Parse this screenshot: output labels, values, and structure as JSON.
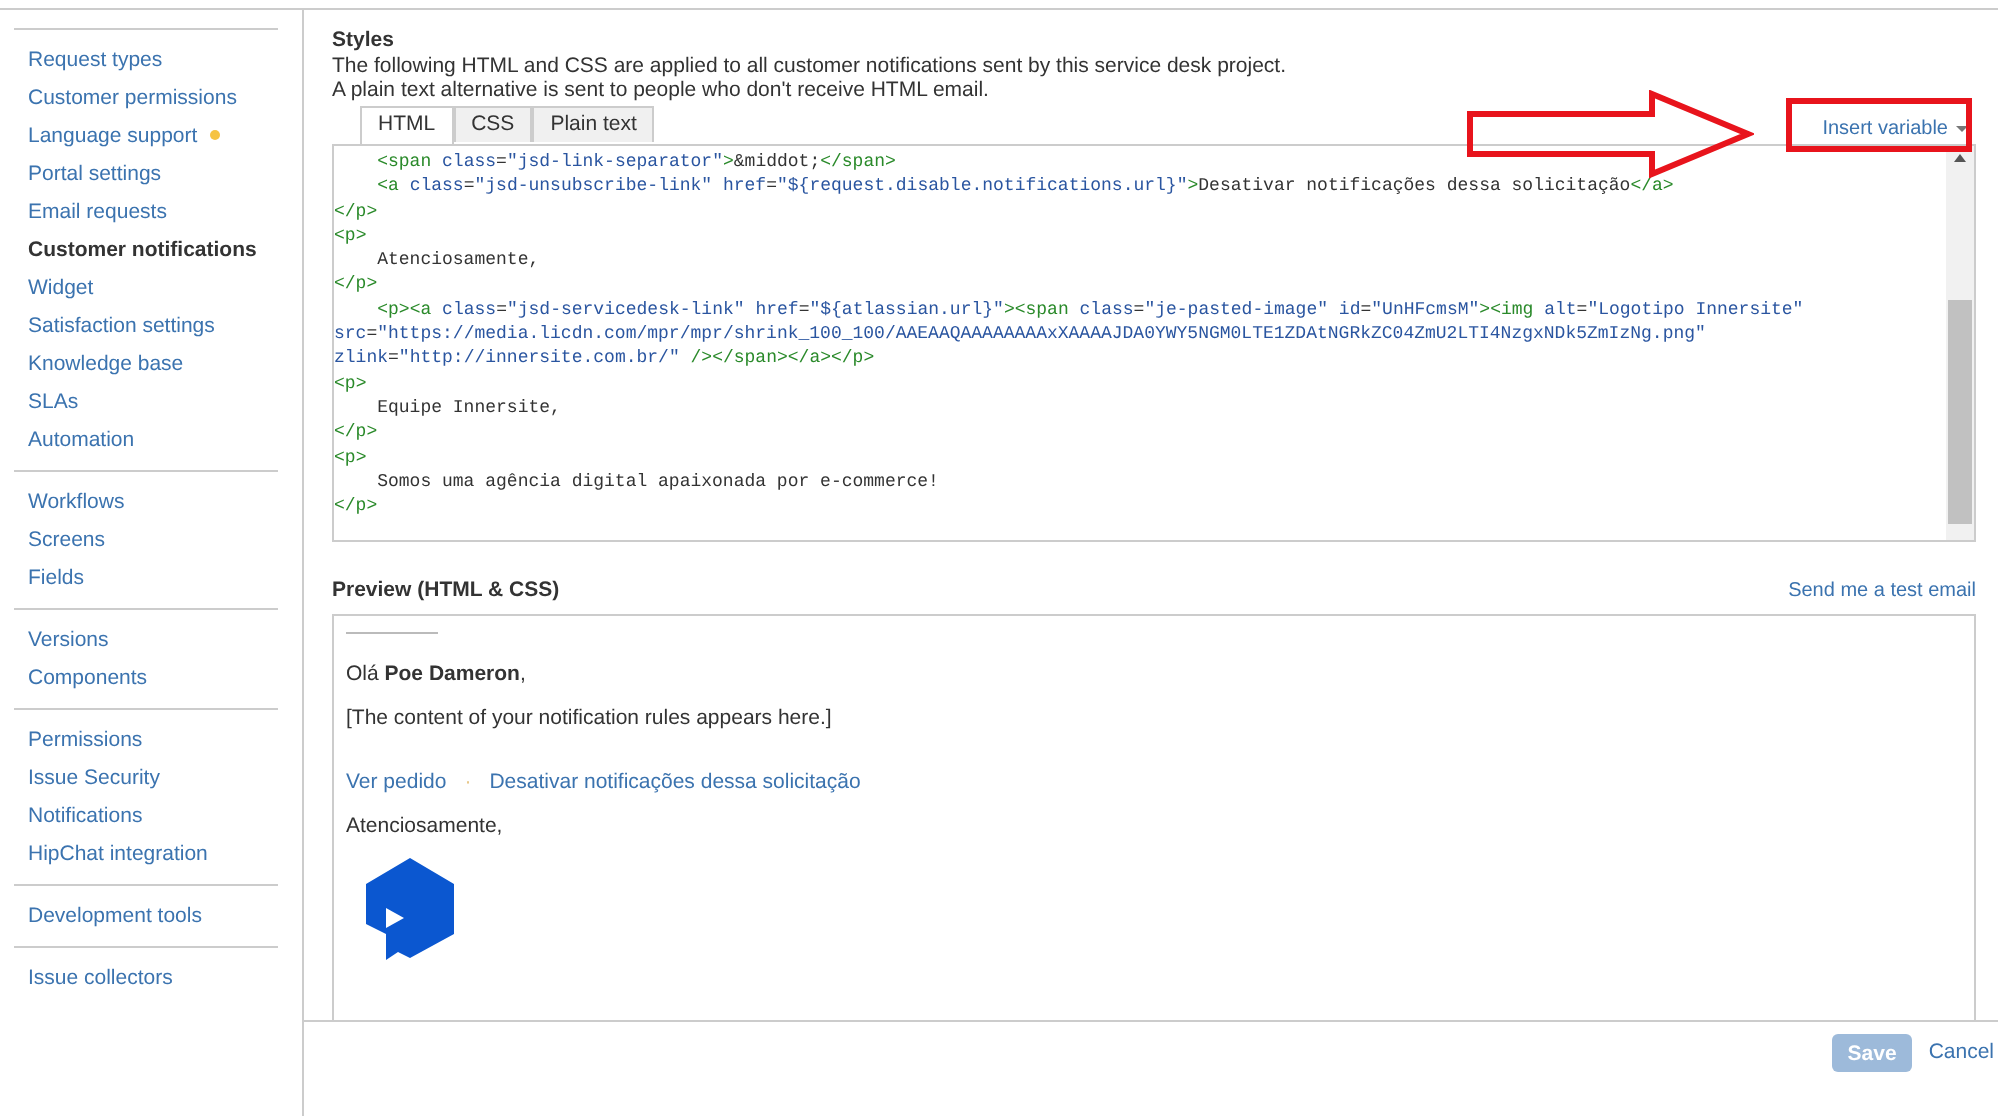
{
  "sidebar": {
    "groups": [
      {
        "items": [
          {
            "label": "Request types",
            "selected": false,
            "dot": false
          },
          {
            "label": "Customer permissions",
            "selected": false,
            "dot": false
          },
          {
            "label": "Language support",
            "selected": false,
            "dot": true
          },
          {
            "label": "Portal settings",
            "selected": false,
            "dot": false
          },
          {
            "label": "Email requests",
            "selected": false,
            "dot": false
          },
          {
            "label": "Customer notifications",
            "selected": true,
            "dot": false
          },
          {
            "label": "Widget",
            "selected": false,
            "dot": false
          },
          {
            "label": "Satisfaction settings",
            "selected": false,
            "dot": false
          },
          {
            "label": "Knowledge base",
            "selected": false,
            "dot": false
          },
          {
            "label": "SLAs",
            "selected": false,
            "dot": false
          },
          {
            "label": "Automation",
            "selected": false,
            "dot": false
          }
        ]
      },
      {
        "items": [
          {
            "label": "Workflows",
            "selected": false,
            "dot": false
          },
          {
            "label": "Screens",
            "selected": false,
            "dot": false
          },
          {
            "label": "Fields",
            "selected": false,
            "dot": false
          }
        ]
      },
      {
        "items": [
          {
            "label": "Versions",
            "selected": false,
            "dot": false
          },
          {
            "label": "Components",
            "selected": false,
            "dot": false
          }
        ]
      },
      {
        "items": [
          {
            "label": "Permissions",
            "selected": false,
            "dot": false
          },
          {
            "label": "Issue Security",
            "selected": false,
            "dot": false
          },
          {
            "label": "Notifications",
            "selected": false,
            "dot": false
          },
          {
            "label": "HipChat integration",
            "selected": false,
            "dot": false
          }
        ]
      },
      {
        "items": [
          {
            "label": "Development tools",
            "selected": false,
            "dot": false
          }
        ]
      },
      {
        "items": [
          {
            "label": "Issue collectors",
            "selected": false,
            "dot": false
          }
        ]
      }
    ]
  },
  "styles": {
    "title": "Styles",
    "description": [
      "The following HTML and CSS are applied to all customer notifications sent by this service desk project.",
      "A plain text alternative is sent to people who don't receive HTML email."
    ],
    "tabs": [
      {
        "label": "HTML",
        "selected": true
      },
      {
        "label": "CSS",
        "selected": false
      },
      {
        "label": "Plain text",
        "selected": false
      }
    ],
    "insert_variable": "Insert variable",
    "editor": {
      "lines": [
        "    <span class=\"jsd-link-separator\">&middot;</span>",
        "    <a class=\"jsd-unsubscribe-link\" href=\"${request.disable.notifications.url}\">Desativar notificações dessa solicitação</a>",
        "</p>",
        "<p>",
        "    Atenciosamente,",
        "</p>",
        "    <p><a class=\"jsd-servicedesk-link\" href=\"${atlassian.url}\"><span class=\"je-pasted-image\" id=\"UnHFcmsM\"><img alt=\"Logotipo Innersite\"",
        "src=\"https://media.licdn.com/mpr/mpr/shrink_100_100/AAEAAQAAAAAAAAxXAAAAJDA0YWY5NGM0LTE1ZDAtNGRkZC04ZmU2LTI4NzgxNDk5ZmIzNg.png\"",
        "zlink=\"http://innersite.com.br/\" /></span></a></p>",
        "<p>",
        "    Equipe Innersite,",
        "</p>",
        "<p>",
        "    Somos uma agência digital apaixonada por e-commerce!",
        "</p>"
      ]
    }
  },
  "preview": {
    "title": "Preview (HTML & CSS)",
    "send_test": "Send me a test email",
    "greeting": "Olá **Poe Dameron**,",
    "content": "[The content of your notification rules appears here.]",
    "links": [
      "Ver pedido",
      "Desativar notificações dessa solicitação"
    ],
    "separator": "·",
    "closing": "Atenciosamente,"
  },
  "footer": {
    "save": {
      "label": "Save",
      "disabled": true
    },
    "cancel": "Cancel"
  }
}
